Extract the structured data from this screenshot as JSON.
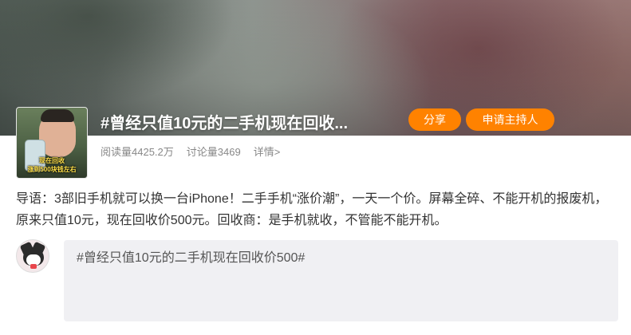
{
  "topic": {
    "title": "#曾经只值10元的二手机现在回收...",
    "share_label": "分享",
    "host_label": "申请主持人",
    "reads": "阅读量4425.2万",
    "discussions": "讨论量3469",
    "details_label": "详情>",
    "thumb_caption_1": "现在回收",
    "thumb_caption_2": "涨到500块钱左右",
    "intro": "导语：3部旧手机就可以换一台iPhone！二手手机“涨价潮”，一天一个价。屏幕全碎、不能开机的报废机，原来只值10元，现在回收价500元。回收商：是手机就收，不管能不能开机。"
  },
  "composer": {
    "value": "#曾经只值10元的二手机现在回收价500#"
  },
  "colors": {
    "accent": "#ff8200",
    "input_bg": "#f0f0f3"
  }
}
